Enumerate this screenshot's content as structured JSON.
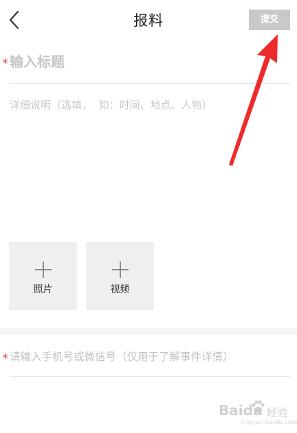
{
  "header": {
    "title": "报料",
    "submit_label": "提交"
  },
  "form": {
    "title_placeholder": "输入标题",
    "description_placeholder": "详细说明（选填，  如：时间、地点、人物）",
    "required_mark": "*",
    "upload": {
      "photo_label": "照片",
      "video_label": "视频"
    },
    "contact_placeholder": "请输入手机号或微信号（仅用于了解事件详情）"
  },
  "colors": {
    "required": "#e0443a",
    "submit_bg": "#c9c9c9",
    "annotation_arrow": "#ee2b2b"
  },
  "icons": {
    "back": "chevron-left-icon",
    "plus": "plus-icon"
  },
  "watermark": {
    "brand": "Baidu",
    "suffix": "经验",
    "url": "jingyan.baidu.com"
  }
}
